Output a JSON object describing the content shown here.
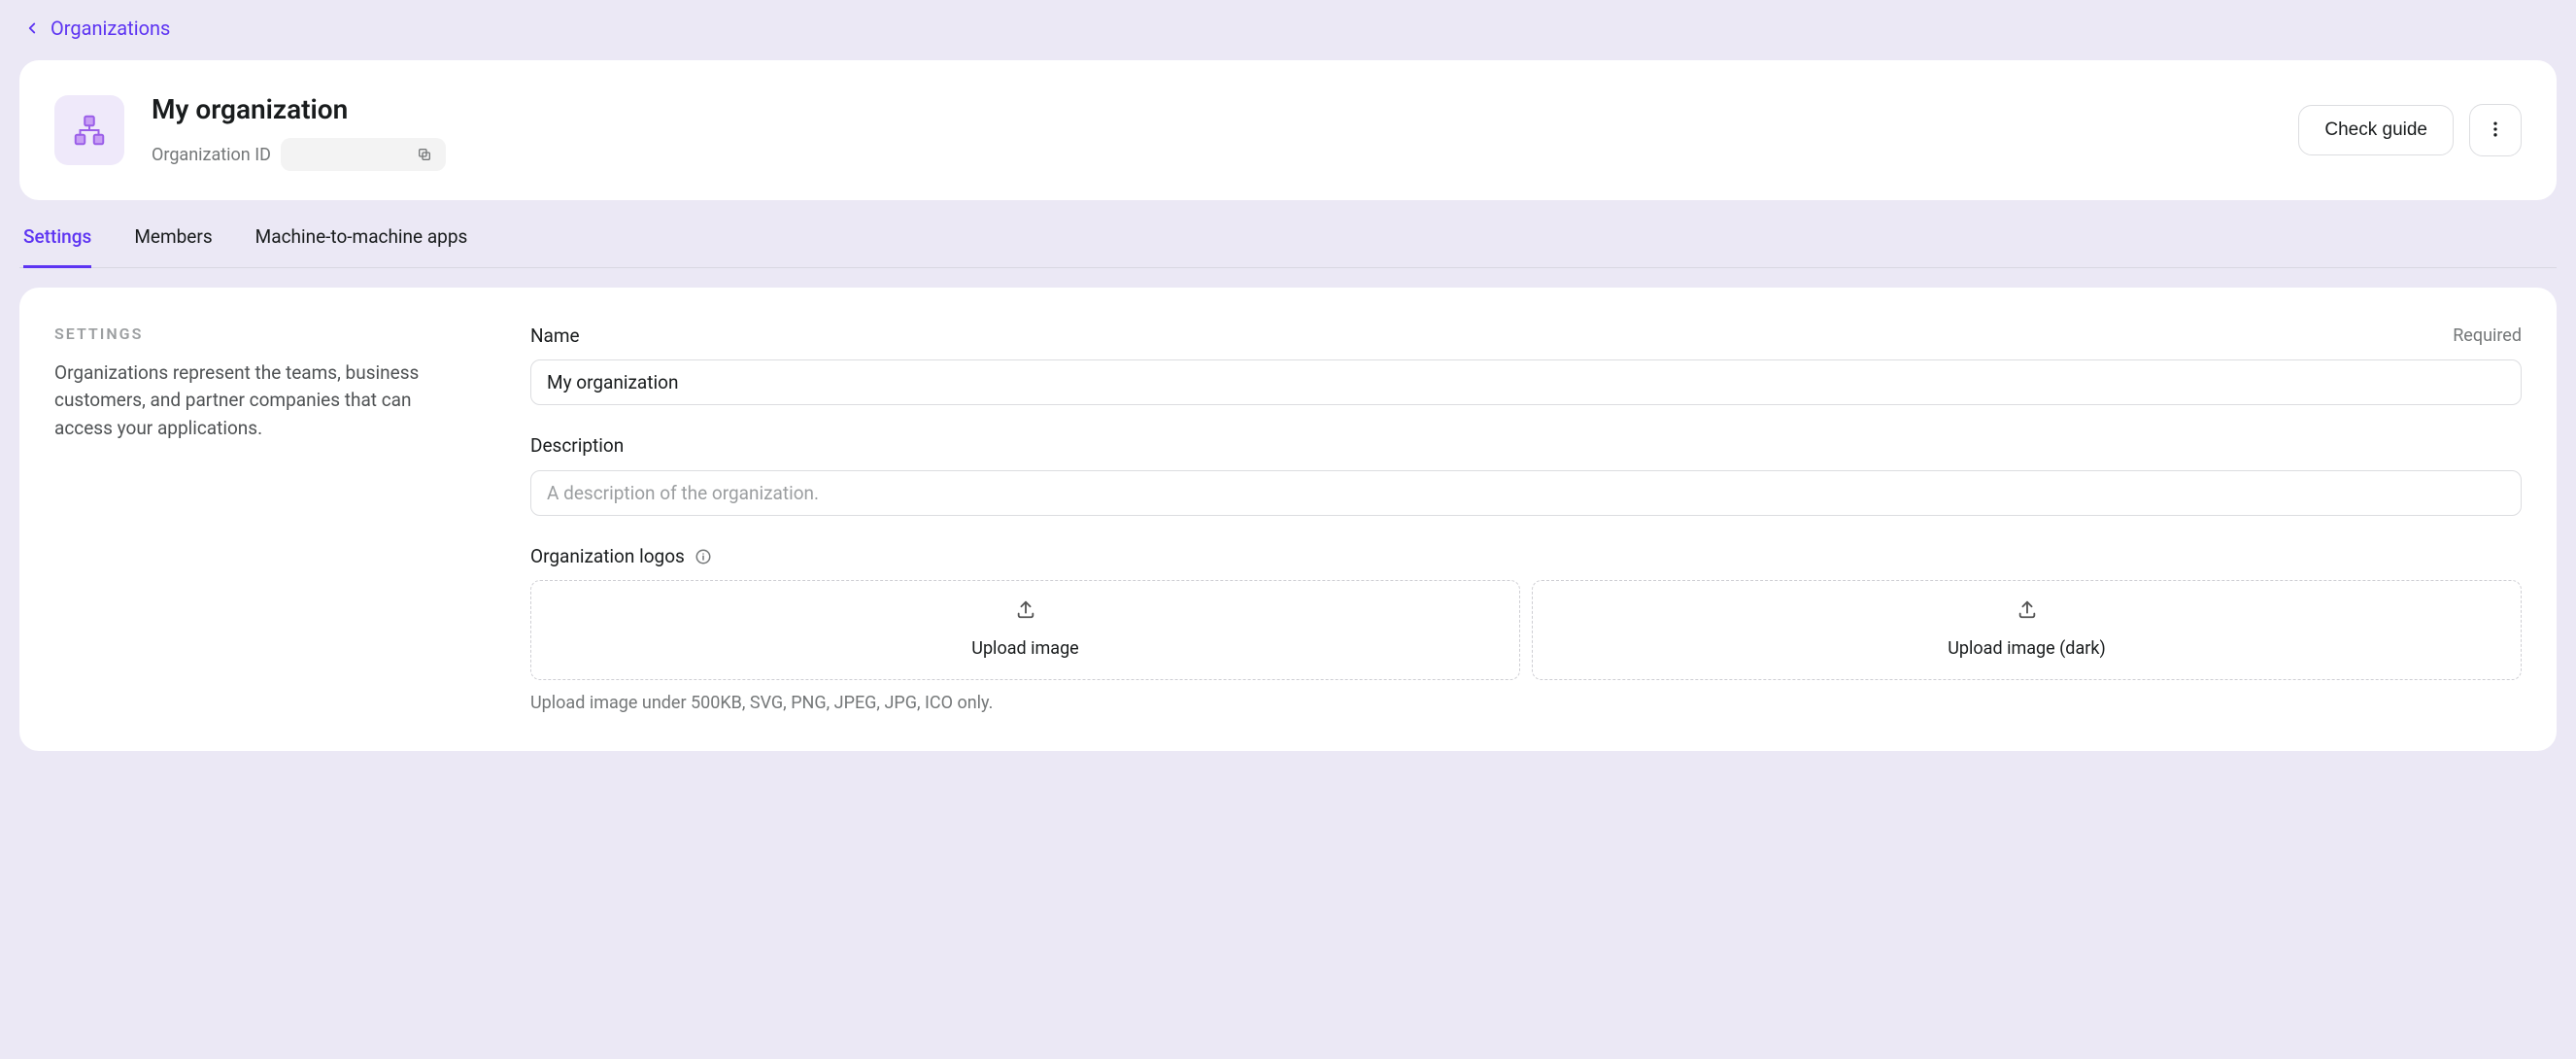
{
  "breadcrumb": {
    "label": "Organizations"
  },
  "header": {
    "title": "My organization",
    "id_label": "Organization ID",
    "id_value": "",
    "check_guide": "Check guide"
  },
  "tabs": [
    {
      "label": "Settings",
      "active": true
    },
    {
      "label": "Members",
      "active": false
    },
    {
      "label": "Machine-to-machine apps",
      "active": false
    }
  ],
  "settings": {
    "section_heading": "SETTINGS",
    "section_desc": "Organizations represent the teams, business customers, and partner companies that can access your applications.",
    "name": {
      "label": "Name",
      "required": "Required",
      "value": "My organization"
    },
    "description": {
      "label": "Description",
      "placeholder": "A description of the organization.",
      "value": ""
    },
    "logos": {
      "label": "Organization logos",
      "upload_light": "Upload image",
      "upload_dark": "Upload image (dark)",
      "hint": "Upload image under 500KB, SVG, PNG, JPEG, JPG, ICO only."
    }
  }
}
